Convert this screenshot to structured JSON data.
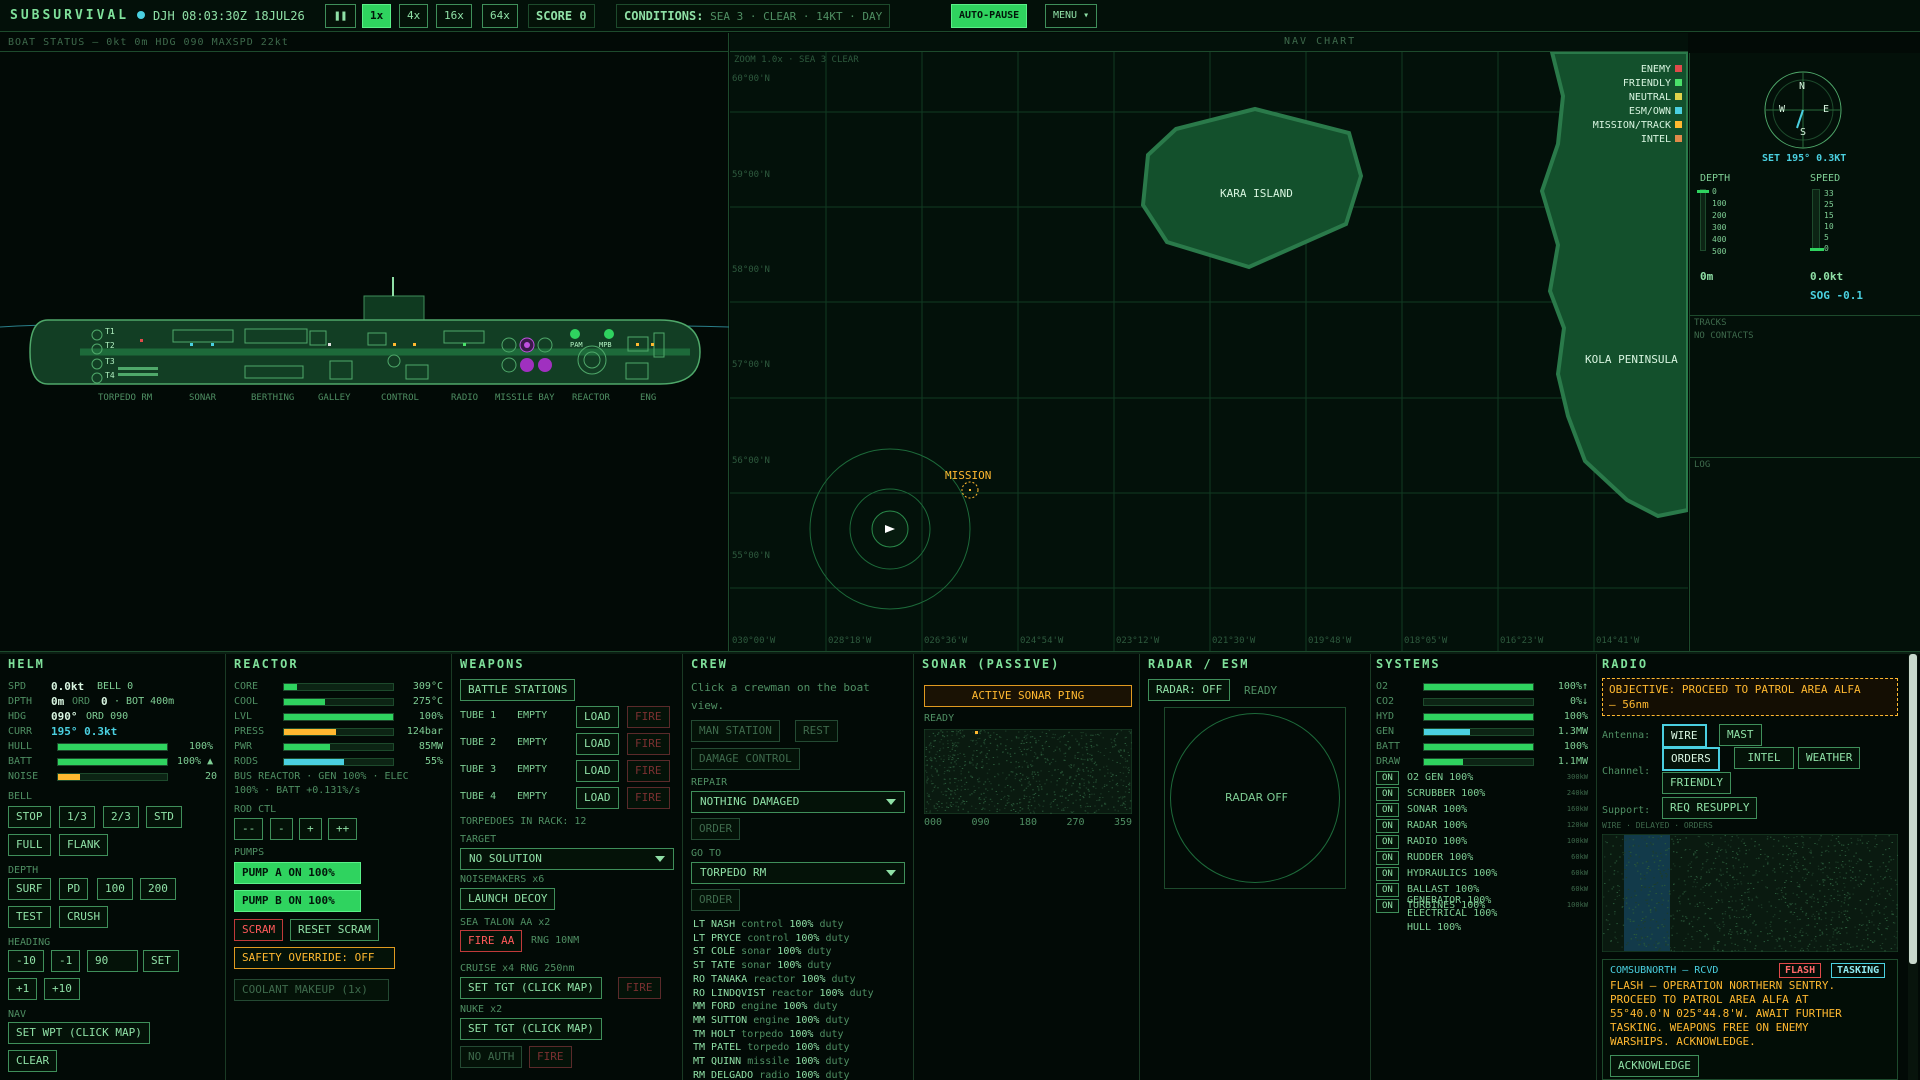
{
  "topbar": {
    "brand": "SUBSURVIVAL",
    "clock": "DJH 08:03:30Z 18JUL26",
    "speeds": [
      "1x",
      "4x",
      "16x",
      "64x"
    ],
    "score": "SCORE 0",
    "conditions_label": "CONDITIONS:",
    "conditions_value": "SEA 3 · CLEAR · 14KT · DAY",
    "auto_pause": "AUTO-PAUSE",
    "menu": "MENU ▾"
  },
  "boat": {
    "status": "BOAT STATUS — 0kt 0m HDG 090 MAXSPD 22kt",
    "tubes": [
      "T1",
      "T2",
      "T3",
      "T4"
    ],
    "compartments": [
      "TORPEDO RM",
      "SONAR",
      "BERTHING",
      "GALLEY",
      "CONTROL",
      "RADIO",
      "MISSILE BAY",
      "REACTOR",
      "ENG"
    ],
    "pam": "PAM",
    "mpb": "MPB"
  },
  "nav": {
    "title": "NAV CHART",
    "zoom": "ZOOM 1.0x · SEA 3 CLEAR",
    "lats": [
      "60°00'N",
      "59°00'N",
      "58°00'N",
      "57°00'N",
      "56°00'N",
      "55°00'N"
    ],
    "lons": [
      "030°00'W",
      "028°18'W",
      "026°36'W",
      "024°54'W",
      "023°12'W",
      "021°30'W",
      "019°48'W",
      "018°05'W",
      "016°23'W",
      "014°41'W"
    ],
    "island": "KARA ISLAND",
    "peninsula": "KOLA PENINSULA",
    "mission": "MISSION",
    "legend": [
      {
        "name": "ENEMY",
        "color": "#e04a4a"
      },
      {
        "name": "FRIENDLY",
        "color": "#4ae06a"
      },
      {
        "name": "NEUTRAL",
        "color": "#e0d24a"
      },
      {
        "name": "ESM/OWN",
        "color": "#4ad0e0"
      },
      {
        "name": "MISSION/TRACK",
        "color": "#ffb830"
      },
      {
        "name": "INTEL",
        "color": "#e08a4a"
      }
    ]
  },
  "compass": {
    "n": "N",
    "s": "S",
    "e": "E",
    "w": "W",
    "set": "SET 195° 0.3KT"
  },
  "gauges": {
    "depth_title": "DEPTH",
    "depth_ticks": [
      "0",
      "100",
      "200",
      "300",
      "400",
      "500"
    ],
    "depth_value": "0m",
    "speed_title": "SPEED",
    "speed_ticks": [
      "33",
      "25",
      "15",
      "10",
      "5",
      "0"
    ],
    "speed_value": "0.0kt",
    "sog": "SOG -0.1",
    "depth_level": 0.0,
    "speed_level": 0.0
  },
  "tracks": {
    "title": "TRACKS",
    "empty": "NO CONTACTS"
  },
  "log": {
    "title": "LOG"
  },
  "helm": {
    "title": "HELM",
    "spd_l": "SPD",
    "spd_v": "0.0kt",
    "bell": "BELL 0",
    "dpth_l": "DPTH",
    "dpth_v": "0m",
    "ord_l": "ORD",
    "ord_v": "0",
    "bot": "· BOT 400m",
    "hdg_l": "HDG",
    "hdg_v": "090°",
    "hdg_ord": "ORD 090",
    "curr_l": "CURR",
    "curr_v": "195° 0.3kt",
    "hull_l": "HULL",
    "hull_v": "100%",
    "hull_level": 1.0,
    "batt_l": "BATT",
    "batt_v": "100% ▲",
    "batt_level": 1.0,
    "noise_l": "NOISE",
    "noise_v": "20",
    "noise_level": 0.2,
    "bell_l": "BELL",
    "bells": [
      "STOP",
      "1/3",
      "2/3",
      "STD",
      "FULL",
      "FLANK"
    ],
    "depth_l": "DEPTH",
    "depths": [
      "SURF",
      "PD",
      "100",
      "200",
      "TEST",
      "CRUSH"
    ],
    "heading_l": "HEADING",
    "head_btns": [
      "-10",
      "-1",
      "90",
      "SET",
      "+1",
      "+10"
    ],
    "nav_l": "NAV",
    "set_wpt": "SET WPT (CLICK MAP)",
    "clear": "CLEAR"
  },
  "reactor": {
    "title": "REACTOR",
    "rows": [
      {
        "l": "CORE",
        "v": "309°C",
        "level": 0.12,
        "c": "#2fd35f"
      },
      {
        "l": "COOL",
        "v": "275°C",
        "level": 0.38,
        "c": "#2fd35f"
      },
      {
        "l": "LVL",
        "v": "100%",
        "level": 1.0,
        "c": "#2fd35f"
      },
      {
        "l": "PRESS",
        "v": "124bar",
        "level": 0.48,
        "c": "#ffb830"
      },
      {
        "l": "PWR",
        "v": "85MW",
        "level": 0.42,
        "c": "#2fd35f"
      },
      {
        "l": "RODS",
        "v": "55%",
        "level": 0.55,
        "c": "#4ad0e0"
      }
    ],
    "bus": "BUS REACTOR · GEN 100% · ELEC",
    "bus2": "100% · BATT +0.131%/s",
    "rod_ctl": "ROD CTL",
    "rod_btns": [
      "--",
      "-",
      "+",
      "++"
    ],
    "pumps": "PUMPS",
    "pump_a": "PUMP A ON 100%",
    "pump_b": "PUMP B ON 100%",
    "scram": "SCRAM",
    "reset": "RESET SCRAM",
    "override": "SAFETY OVERRIDE: OFF",
    "coolant": "COOLANT MAKEUP (1x)"
  },
  "weapons": {
    "title": "WEAPONS",
    "battle": "BATTLE STATIONS",
    "tubes": [
      {
        "n": "TUBE 1",
        "s": "EMPTY"
      },
      {
        "n": "TUBE 2",
        "s": "EMPTY"
      },
      {
        "n": "TUBE 3",
        "s": "EMPTY"
      },
      {
        "n": "TUBE 4",
        "s": "EMPTY"
      }
    ],
    "load": "LOAD",
    "fire": "FIRE",
    "rack": "TORPEDOES IN RACK: 12",
    "target_l": "TARGET",
    "target_v": "NO SOLUTION",
    "noise_l": "NOISEMAKERS x6",
    "decoy": "LAUNCH DECOY",
    "aa_l": "SEA TALON AA x2",
    "fire_aa": "FIRE AA",
    "rng": "RNG 10NM",
    "cruise_l": "CRUISE x4 RNG 250nm",
    "set_tgt": "SET TGT (CLICK MAP)",
    "nuke_l": "NUKE x2",
    "no_auth": "NO AUTH"
  },
  "crew": {
    "title": "CREW",
    "hint": "Click a crewman on the boat",
    "hint2": "view.",
    "man": "MAN STATION",
    "rest": "REST",
    "dmg": "DAMAGE CONTROL",
    "repair_l": "REPAIR",
    "repair_v": "NOTHING DAMAGED",
    "order": "ORDER",
    "goto_l": "GO TO",
    "goto_v": "TORPEDO RM",
    "list": [
      {
        "r": "LT NASH",
        "s": "control",
        "p": "100%"
      },
      {
        "r": "LT PRYCE",
        "s": "control",
        "p": "100%"
      },
      {
        "r": "ST COLE",
        "s": "sonar",
        "p": "100%"
      },
      {
        "r": "ST TATE",
        "s": "sonar",
        "p": "100%"
      },
      {
        "r": "RO TANAKA",
        "s": "reactor",
        "p": "100%"
      },
      {
        "r": "RO LINDQVIST",
        "s": "reactor",
        "p": "100%"
      },
      {
        "r": "MM FORD",
        "s": "engine",
        "p": "100%"
      },
      {
        "r": "MM SUTTON",
        "s": "engine",
        "p": "100%"
      },
      {
        "r": "TM HOLT",
        "s": "torpedo",
        "p": "100%"
      },
      {
        "r": "TM PATEL",
        "s": "torpedo",
        "p": "100%"
      },
      {
        "r": "MT QUINN",
        "s": "missile",
        "p": "100%"
      },
      {
        "r": "RM DELGADO",
        "s": "radio",
        "p": "100%"
      }
    ],
    "duty": "duty"
  },
  "sonar": {
    "title": "SONAR (PASSIVE)",
    "ping": "ACTIVE SONAR PING",
    "ready": "READY",
    "bearings": [
      "000",
      "090",
      "180",
      "270",
      "359"
    ]
  },
  "radar": {
    "title": "RADAR / ESM",
    "toggle": "RADAR: OFF",
    "ready": "READY",
    "off": "RADAR OFF"
  },
  "systems": {
    "title": "SYSTEMS",
    "bars": [
      {
        "l": "O2",
        "v": "100%↑",
        "level": 1.0,
        "c": "#2fd35f"
      },
      {
        "l": "CO2",
        "v": "0%↓",
        "level": 0.0,
        "c": "#2fd35f"
      },
      {
        "l": "HYD",
        "v": "100%",
        "level": 1.0,
        "c": "#2fd35f"
      },
      {
        "l": "GEN",
        "v": "1.3MW",
        "level": 0.42,
        "c": "#4ad0e0"
      },
      {
        "l": "BATT",
        "v": "100%",
        "level": 1.0,
        "c": "#2fd35f"
      },
      {
        "l": "DRAW",
        "v": "1.1MW",
        "level": 0.36,
        "c": "#2fd35f"
      }
    ],
    "on": "ON",
    "items": [
      {
        "n": "O2 GEN",
        "p": "100%",
        "w": "300kW"
      },
      {
        "n": "SCRUBBER",
        "p": "100%",
        "w": "240kW"
      },
      {
        "n": "SONAR",
        "p": "100%",
        "w": "160kW"
      },
      {
        "n": "RADAR",
        "p": "100%",
        "w": "120kW"
      },
      {
        "n": "RADIO",
        "p": "100%",
        "w": "100kW"
      },
      {
        "n": "RUDDER",
        "p": "100%",
        "w": "60kW"
      },
      {
        "n": "HYDRAULICS",
        "p": "100%",
        "w": "60kW"
      },
      {
        "n": "BALLAST",
        "p": "100%",
        "w": "60kW"
      },
      {
        "n": "TURBINES",
        "p": "100%",
        "w": "100kW"
      }
    ],
    "extra": [
      {
        "n": "GENERATOR",
        "p": "100%"
      },
      {
        "n": "ELECTRICAL",
        "p": "100%"
      },
      {
        "n": "HULL",
        "p": "100%"
      }
    ]
  },
  "radio": {
    "title": "RADIO",
    "objective": "OBJECTIVE: PROCEED TO PATROL AREA ALFA",
    "objective2": "— 56nm",
    "antenna_l": "Antenna:",
    "wire": "WIRE",
    "mast": "MAST",
    "channel_l": "Channel:",
    "channels": [
      "ORDERS",
      "INTEL",
      "WEATHER",
      "FRIENDLY"
    ],
    "support_l": "Support:",
    "resupply": "REQ RESUPPLY",
    "status": "WIRE · DELAYED · ORDERS",
    "from": "COMSUBNORTH — RCVD",
    "flash": "FLASH",
    "tasking": "TASKING",
    "msg": [
      "FLASH — OPERATION NORTHERN SENTRY.",
      "PROCEED TO PATROL AREA ALFA AT",
      "55°40.0'N 025°44.8'W. AWAIT FURTHER",
      "TASKING. WEAPONS FREE ON ENEMY",
      "WARSHIPS. ACKNOWLEDGE."
    ],
    "ack": "ACKNOWLEDGE"
  }
}
